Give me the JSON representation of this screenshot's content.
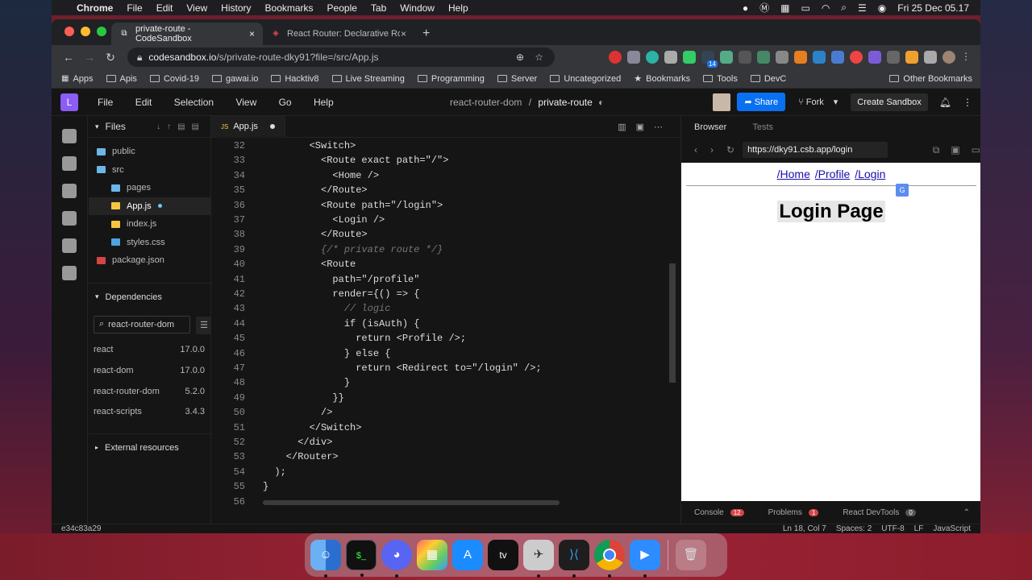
{
  "menubar": {
    "app": "Chrome",
    "items": [
      "File",
      "Edit",
      "View",
      "History",
      "Bookmarks",
      "People",
      "Tab",
      "Window",
      "Help"
    ],
    "clock": "Fri 25 Dec  05.17"
  },
  "browser": {
    "tabs": [
      {
        "title": "private-route - CodeSandbox",
        "active": true
      },
      {
        "title": "React Router: Declarative Rout",
        "active": false
      }
    ],
    "url_host": "codesandbox.io",
    "url_path": "/s/private-route-dky91?file=/src/App.js",
    "bookmarks": [
      "Apps",
      "Apis",
      "Covid-19",
      "gawai.io",
      "Hacktiv8",
      "Live Streaming",
      "Programming",
      "Server",
      "Uncategorized",
      "Bookmarks",
      "Tools",
      "DevC"
    ],
    "other_bookmarks": "Other Bookmarks",
    "ext_badge": "14"
  },
  "codesandbox": {
    "logo": "L",
    "menu": [
      "File",
      "Edit",
      "Selection",
      "View",
      "Go",
      "Help"
    ],
    "project": "react-router-dom",
    "separator": "/",
    "sandbox": "private-route",
    "share": "Share",
    "fork": "Fork",
    "create": "Create Sandbox",
    "files_title": "Files",
    "files": [
      {
        "name": "public",
        "type": "folder",
        "indent": 0
      },
      {
        "name": "src",
        "type": "folder",
        "indent": 0
      },
      {
        "name": "pages",
        "type": "folder",
        "indent": 1
      },
      {
        "name": "App.js",
        "type": "js",
        "indent": 1,
        "selected": true,
        "modified": true
      },
      {
        "name": "index.js",
        "type": "js",
        "indent": 1
      },
      {
        "name": "styles.css",
        "type": "css",
        "indent": 1
      },
      {
        "name": "package.json",
        "type": "json",
        "indent": 0
      }
    ],
    "dependencies_title": "Dependencies",
    "dep_search": "react-router-dom",
    "dependencies": [
      {
        "name": "react",
        "version": "17.0.0"
      },
      {
        "name": "react-dom",
        "version": "17.0.0"
      },
      {
        "name": "react-router-dom",
        "version": "5.2.0"
      },
      {
        "name": "react-scripts",
        "version": "3.4.3"
      }
    ],
    "external_resources": "External resources",
    "editor_tab": "App.js",
    "editor_tab_badge": "JS",
    "code_lines": [
      {
        "n": "32",
        "t": "        <Switch>"
      },
      {
        "n": "33",
        "t": "          <Route exact path=\"/\">"
      },
      {
        "n": "34",
        "t": "            <Home />"
      },
      {
        "n": "35",
        "t": "          </Route>"
      },
      {
        "n": "36",
        "t": "          <Route path=\"/login\">"
      },
      {
        "n": "37",
        "t": "            <Login />"
      },
      {
        "n": "38",
        "t": "          </Route>"
      },
      {
        "n": "39",
        "t": "          {/* private route */}"
      },
      {
        "n": "40",
        "t": "          <Route"
      },
      {
        "n": "41",
        "t": "            path=\"/profile\""
      },
      {
        "n": "42",
        "t": "            render={() => {"
      },
      {
        "n": "43",
        "t": "              // logic"
      },
      {
        "n": "44",
        "t": "              if (isAuth) {"
      },
      {
        "n": "45",
        "t": "                return <Profile />;"
      },
      {
        "n": "46",
        "t": "              } else {"
      },
      {
        "n": "47",
        "t": "                return <Redirect to=\"/login\" />;"
      },
      {
        "n": "48",
        "t": "              }"
      },
      {
        "n": "49",
        "t": "            }}"
      },
      {
        "n": "50",
        "t": "          />"
      },
      {
        "n": "51",
        "t": "        </Switch>"
      },
      {
        "n": "52",
        "t": "      </div>"
      },
      {
        "n": "53",
        "t": "    </Router>"
      },
      {
        "n": "54",
        "t": "  );"
      },
      {
        "n": "55",
        "t": "}"
      },
      {
        "n": "56",
        "t": ""
      }
    ],
    "preview_tabs": [
      "Browser",
      "Tests"
    ],
    "preview_url": "https://dky91.csb.app/login",
    "preview_links": [
      "/Home",
      "/Profile",
      "/Login"
    ],
    "preview_heading": "Login Page",
    "bottom_tabs": [
      {
        "label": "Console",
        "count": "12"
      },
      {
        "label": "Problems",
        "count": "1"
      },
      {
        "label": "React DevTools",
        "count": "0"
      }
    ],
    "status_left": "e34c83a29",
    "status_right": [
      "Ln 18, Col 7",
      "Spaces: 2",
      "UTF-8",
      "LF",
      "JavaScript"
    ]
  },
  "dock": [
    "Finder",
    "Terminal",
    "Discord",
    "Launchpad",
    "App Store",
    "Apple TV",
    "Simulator",
    "Visual Studio Code",
    "Google Chrome",
    "Zoom",
    "Trash"
  ]
}
